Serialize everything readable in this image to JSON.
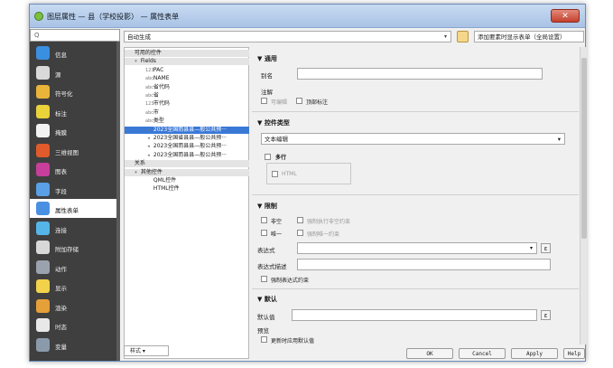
{
  "window": {
    "title": "图层属性 — 县（学校投影） — 属性表单",
    "close": "✕"
  },
  "sidebar": {
    "search_placeholder": "Q",
    "items": [
      {
        "label": "信息",
        "icon": "info-icon",
        "color": "#3b8fe0"
      },
      {
        "label": "源",
        "icon": "source-icon",
        "color": "#d9d9d9"
      },
      {
        "label": "符号化",
        "icon": "symbology-icon",
        "color": "#e9b43a"
      },
      {
        "label": "标注",
        "icon": "labels-icon",
        "color": "#e9d23a"
      },
      {
        "label": "掩膜",
        "icon": "mask-icon",
        "color": "#f2f2f2"
      },
      {
        "label": "三维视图",
        "icon": "3d-view-icon",
        "color": "#e05a2b"
      },
      {
        "label": "图表",
        "icon": "diagram-icon",
        "color": "#c73f9a"
      },
      {
        "label": "字段",
        "icon": "fields-icon",
        "color": "#5aa0e6"
      },
      {
        "label": "属性表单",
        "icon": "attributes-form-icon",
        "color": "#4a90e2"
      },
      {
        "label": "连接",
        "icon": "joins-icon",
        "color": "#55b5e8"
      },
      {
        "label": "附加存储",
        "icon": "auxiliary-storage-icon",
        "color": "#d8d8d8"
      },
      {
        "label": "动作",
        "icon": "actions-icon",
        "color": "#9aa3ad"
      },
      {
        "label": "显示",
        "icon": "display-icon",
        "color": "#f2d24a"
      },
      {
        "label": "渲染",
        "icon": "rendering-icon",
        "color": "#e6a03a"
      },
      {
        "label": "时态",
        "icon": "temporal-icon",
        "color": "#e8e8e8"
      },
      {
        "label": "变量",
        "icon": "variables-icon",
        "color": "#8a9aab"
      }
    ]
  },
  "topbar": {
    "mode": "自动生成",
    "mode_arrow": "▾",
    "right_combo": "添加要素时显示表单（全局设置）",
    "right_arrow": "▾"
  },
  "tree": {
    "rows": [
      {
        "text": "可用的控件",
        "type": "head",
        "indent": 0,
        "icon": ""
      },
      {
        "text": "Fields",
        "type": "head",
        "indent": 1,
        "icon": "▾"
      },
      {
        "text": "PAC",
        "type": "normal",
        "indent": 3,
        "icon": "123"
      },
      {
        "text": "NAME",
        "type": "normal",
        "indent": 3,
        "icon": "abc"
      },
      {
        "text": "省代码",
        "type": "normal",
        "indent": 3,
        "icon": "abc"
      },
      {
        "text": "省",
        "type": "normal",
        "indent": 3,
        "icon": "abc"
      },
      {
        "text": "市代码",
        "type": "normal",
        "indent": 3,
        "icon": "123"
      },
      {
        "text": "市",
        "type": "normal",
        "indent": 3,
        "icon": "abc"
      },
      {
        "text": "类型",
        "type": "normal",
        "indent": 3,
        "icon": "abc"
      },
      {
        "text": "2023全国而县县—般公共预···",
        "type": "sel",
        "indent": 3,
        "icon": "◂"
      },
      {
        "text": "2023全国省县县—般公共预···",
        "type": "normal",
        "indent": 3,
        "icon": "◂"
      },
      {
        "text": "2023全国而县县—般公共预···",
        "type": "normal",
        "indent": 3,
        "icon": "◂"
      },
      {
        "text": "2023全国而县县—般公共预···",
        "type": "normal",
        "indent": 3,
        "icon": "◂"
      },
      {
        "text": "关系",
        "type": "head",
        "indent": 0,
        "icon": ""
      },
      {
        "text": "其他控件",
        "type": "head",
        "indent": 1,
        "icon": "▾"
      },
      {
        "text": "QML控件",
        "type": "normal",
        "indent": 3,
        "icon": ""
      },
      {
        "text": "HTML控件",
        "type": "normal",
        "indent": 3,
        "icon": ""
      }
    ],
    "bottom_combo": "样式"
  },
  "form": {
    "general": {
      "title": "通用",
      "alias": "别名",
      "comment": "注解",
      "editable": "可编辑",
      "label_on_top": "顶部标注"
    },
    "widget": {
      "title": "控件类型",
      "type_value": "文本编辑",
      "multiline": "多行",
      "html": "HTML"
    },
    "constraints": {
      "title": "限制",
      "not_null": "非空",
      "enforce_not_null": "强制执行非空约束",
      "unique": "唯一",
      "enforce_unique": "强制唯一约束",
      "expression": "表达式",
      "expression_desc": "表达式描述",
      "enforce_expression": "强制表达式约束",
      "eps": "ε"
    },
    "defaults": {
      "title": "默认",
      "default_value": "默认值",
      "preview": "预览",
      "apply_on_update": "更新时应用默认值"
    }
  },
  "buttons": {
    "ok": "OK",
    "cancel": "Cancel",
    "apply": "Apply",
    "help": "Help"
  }
}
